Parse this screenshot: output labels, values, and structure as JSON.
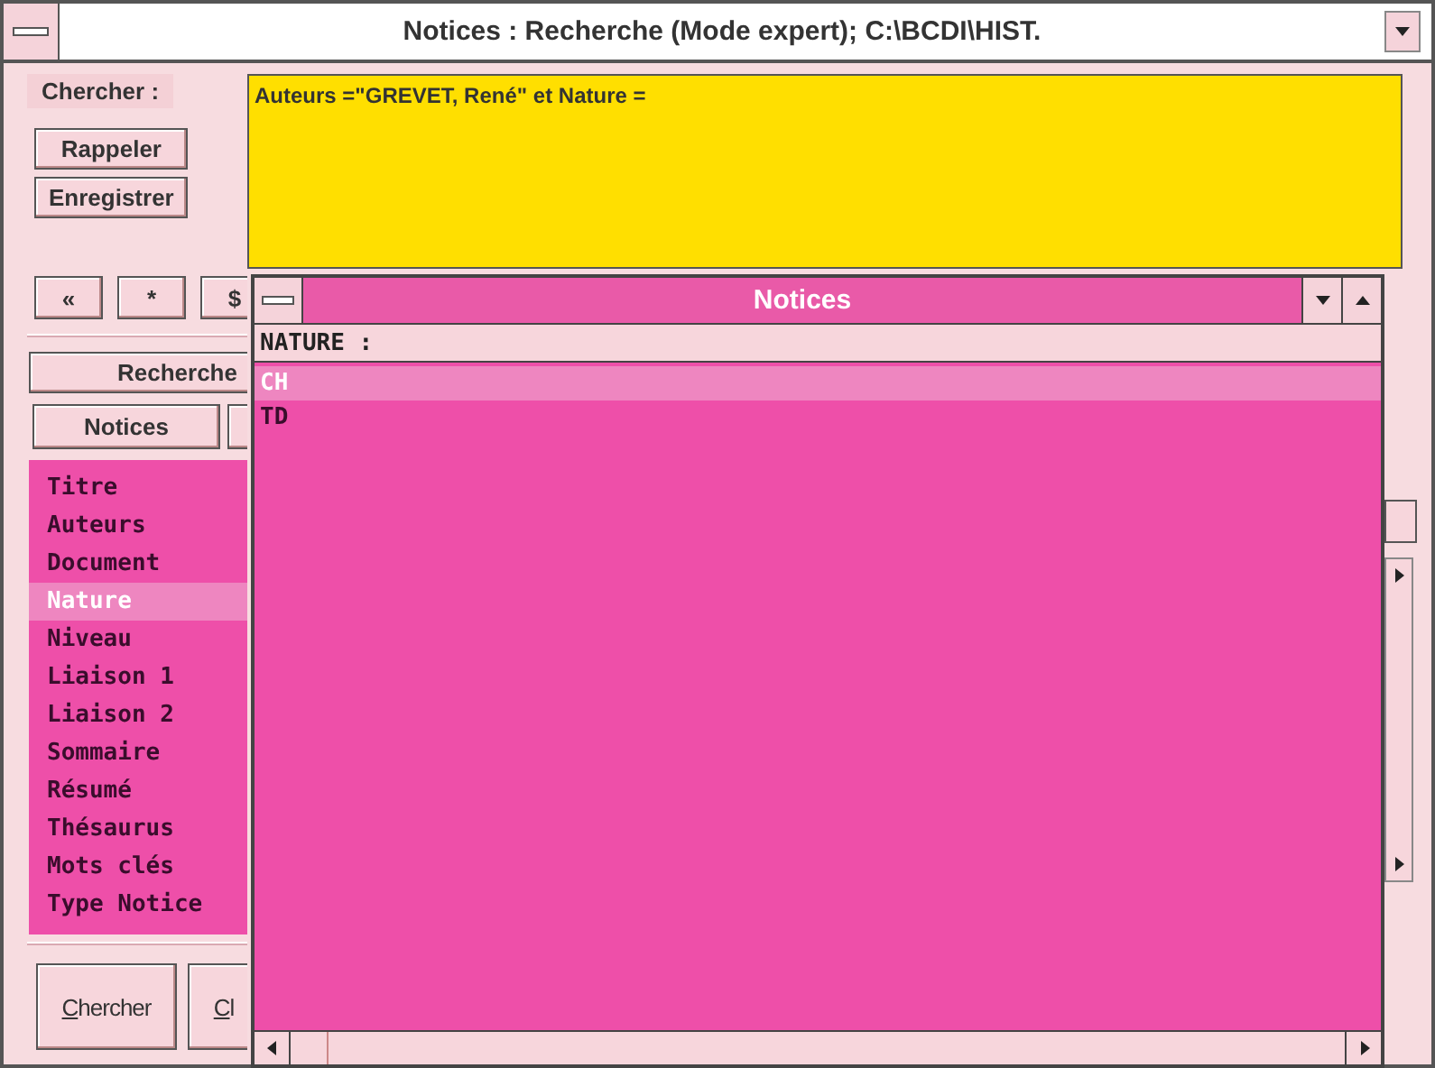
{
  "window": {
    "title": "Notices : Recherche (Mode expert); C:\\BCDI\\HIST."
  },
  "search_label": "Chercher :",
  "side_buttons": [
    "Rappeler",
    "Enregistrer"
  ],
  "query": "Auteurs =\"GREVET, René\" et  Nature  =",
  "operator_buttons": [
    "«",
    "*",
    "$"
  ],
  "mode_button": "Recherche",
  "tab_buttons": [
    "Notices"
  ],
  "fields": [
    {
      "label": "Titre",
      "selected": false
    },
    {
      "label": "Auteurs",
      "selected": false
    },
    {
      "label": "Document",
      "selected": false
    },
    {
      "label": "Nature",
      "selected": true
    },
    {
      "label": "Niveau",
      "selected": false
    },
    {
      "label": "Liaison 1",
      "selected": false
    },
    {
      "label": "Liaison 2",
      "selected": false
    },
    {
      "label": "Sommaire",
      "selected": false
    },
    {
      "label": "Résumé",
      "selected": false
    },
    {
      "label": "Thésaurus",
      "selected": false
    },
    {
      "label": "Mots clés",
      "selected": false
    },
    {
      "label": "Type Notice",
      "selected": false
    }
  ],
  "bottom_buttons": [
    "Chercher",
    "Cl"
  ],
  "popup": {
    "title": "Notices",
    "header": "NATURE :",
    "items": [
      {
        "label": "CH",
        "selected": true
      },
      {
        "label": "TD",
        "selected": false
      }
    ]
  }
}
